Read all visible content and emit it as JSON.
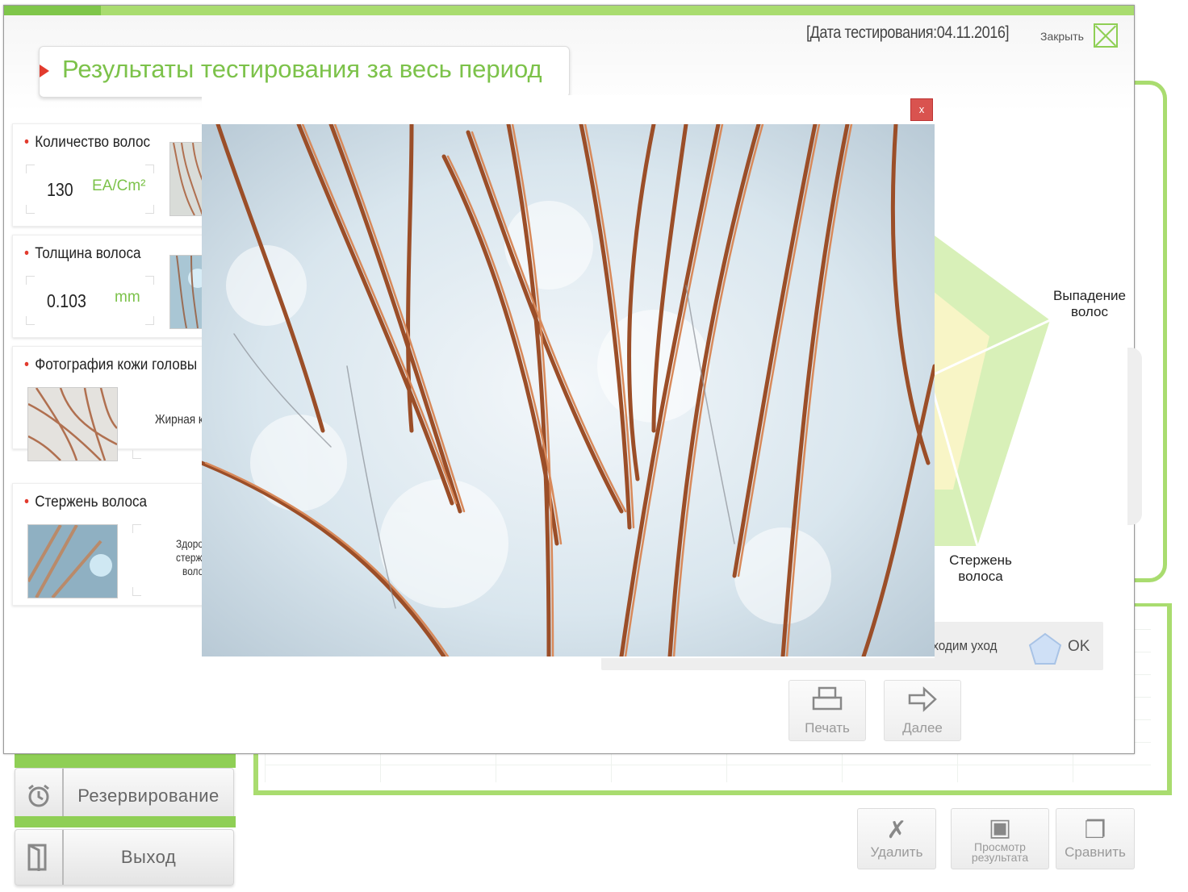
{
  "background": {
    "side_menu": [
      {
        "label": "Резервирование",
        "icon": "alarm-clock-icon"
      },
      {
        "label": "Выход",
        "icon": "exit-door-icon"
      }
    ],
    "bottom_buttons": [
      {
        "label": "Удалить",
        "icon": "delete-icon"
      },
      {
        "label_line1": "Просмотр",
        "label_line2": "результата",
        "icon": "view-result-icon"
      },
      {
        "label": "Сравнить",
        "icon": "compare-icon"
      }
    ]
  },
  "dialog": {
    "date_label": "[Дата тестирования:04.11.2016]",
    "close_label": "Закрыть",
    "title": "Результаты тестирования за весь период",
    "cards": {
      "hair_count": {
        "title": "Количество волос",
        "value": "130",
        "unit": "EA/Cm²"
      },
      "hair_thickness": {
        "title": "Толщина волоса",
        "value": "0.103",
        "unit": "mm"
      },
      "scalp_photo": {
        "title": "Фотография кожи головы",
        "result": "Жирная кожа"
      },
      "hair_shaft": {
        "title": "Стержень волоса",
        "result_line1": "Здоровый",
        "result_line2": "стержень",
        "result_line3": "волоса"
      }
    },
    "radar": {
      "label_hair_loss": "Выпадение волос",
      "label_hair_shaft": "Стержень волоса"
    },
    "care": {
      "text": "Необходим уход",
      "ok_label": "OK"
    },
    "actions": {
      "print_label": "Печать",
      "next_label": "Далее"
    },
    "popup": {
      "close_label": "x"
    }
  },
  "colors": {
    "accent_green": "#7cc24a",
    "frame_green": "#a9dc6f",
    "marker_red": "#e23b2e",
    "hair_copper": "#b8683c"
  }
}
